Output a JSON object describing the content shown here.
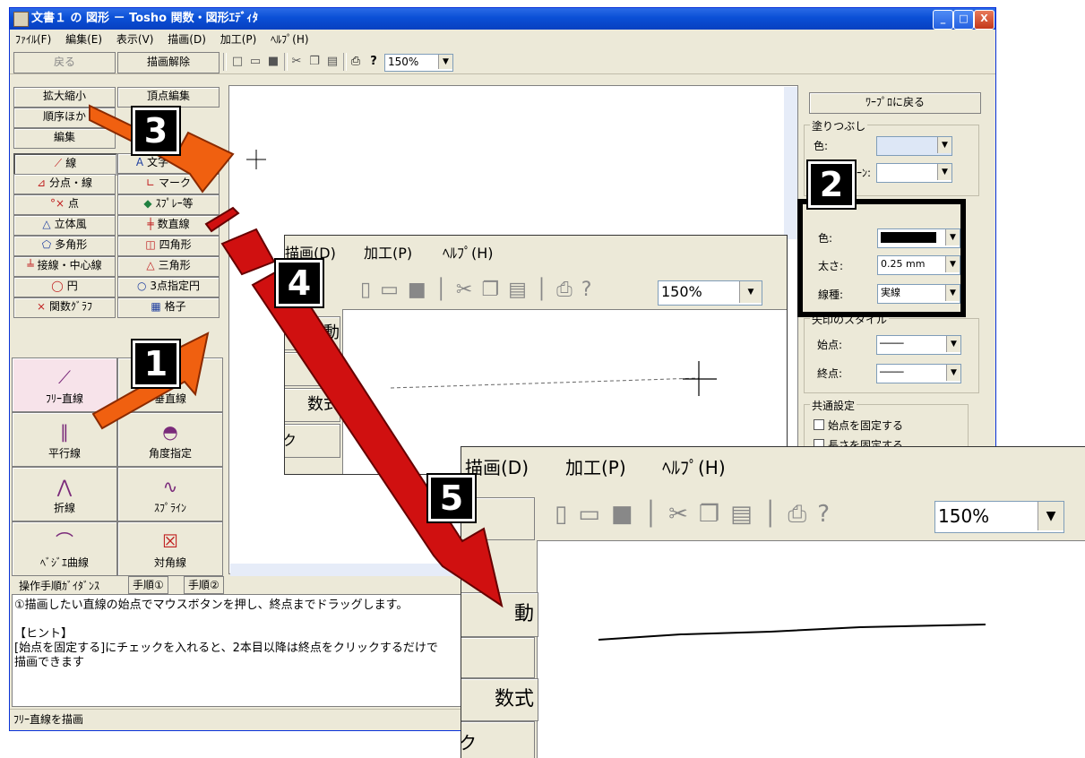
{
  "window": {
    "title": "文書１ の 図形 － Tosho 関数・図形ｴﾃﾞｨﾀ",
    "caption_buttons": [
      "_",
      "□",
      "X"
    ]
  },
  "menu": [
    "ﾌｧｲﾙ(F)",
    "編集(E)",
    "表示(V)",
    "描画(D)",
    "加工(P)",
    "ﾍﾙﾌﾟ(H)"
  ],
  "toolbar": {
    "back": "戻る",
    "clear": "描画解除",
    "zoom": "150%"
  },
  "left_panel": {
    "row_a": [
      "拡大縮小",
      "頂点編集"
    ],
    "row_b": [
      "順序ほか",
      "編集"
    ],
    "tools": [
      "線",
      "文字・数式",
      "分点・線",
      "マーク",
      "点",
      "ｽﾌﾟﾚｰ等",
      "立体風",
      "数直線",
      "多角形",
      "四角形",
      "接線・中心線",
      "三角形",
      "円",
      "3点指定円",
      "関数ｸﾞﾗﾌ",
      "格子"
    ],
    "big_tools": [
      "ﾌﾘｰ直線",
      "垂直線",
      "平行線",
      "角度指定",
      "折線",
      "ｽﾌﾟﾗｲﾝ",
      "ﾍﾞｼﾞｴ曲線",
      "対角線"
    ]
  },
  "right_panel": {
    "back_word": "ﾜｰﾌﾟﾛに戻る",
    "fill_group": "塗りつぶし",
    "fill_color_label": "色:",
    "pattern_label": "ﾊﾟﾀｰﾝ:",
    "line_color_label": "色:",
    "thickness_label": "太さ:",
    "thickness_value": "0.25 mm",
    "linetype_label": "線種:",
    "linetype_value": "実線",
    "arrow_group": "矢印のスタイル",
    "start_label": "始点:",
    "end_label": "終点:",
    "common_group": "共通設定",
    "fix_start": "始点を固定する",
    "fix_length": "長さを固定する"
  },
  "guide": {
    "tabs": [
      "操作手順ｶﾞｲﾀﾞﾝｽ",
      "手順①",
      "手順②"
    ],
    "text": "①描画したい直線の始点でマウスボタンを押し、終点までドラッグします。\n\n【ヒント】\n[始点を固定する]にチェックを入れると、2本目以降は終点をクリックするだけで\n描画できます"
  },
  "status": "ﾌﾘｰ直線を描画",
  "zoom_panel_4": {
    "menu": [
      "描画(D)",
      "加工(P)",
      "ﾍﾙﾌﾟ(H)"
    ],
    "zoom": "150%",
    "side": [
      "動",
      "数式",
      "ク"
    ]
  },
  "zoom_panel_5": {
    "menu": [
      "描画(D)",
      "加工(P)",
      "ﾍﾙﾌﾟ(H)"
    ],
    "zoom": "150%",
    "side": [
      "動",
      "数式",
      "ク"
    ]
  },
  "callouts": [
    "1",
    "2",
    "3",
    "4",
    "5"
  ],
  "colors": {
    "title_blue": "#0a4fd6",
    "arrow_orange": "#f06010",
    "arrow_red": "#d01010",
    "face": "#ece9d8"
  }
}
